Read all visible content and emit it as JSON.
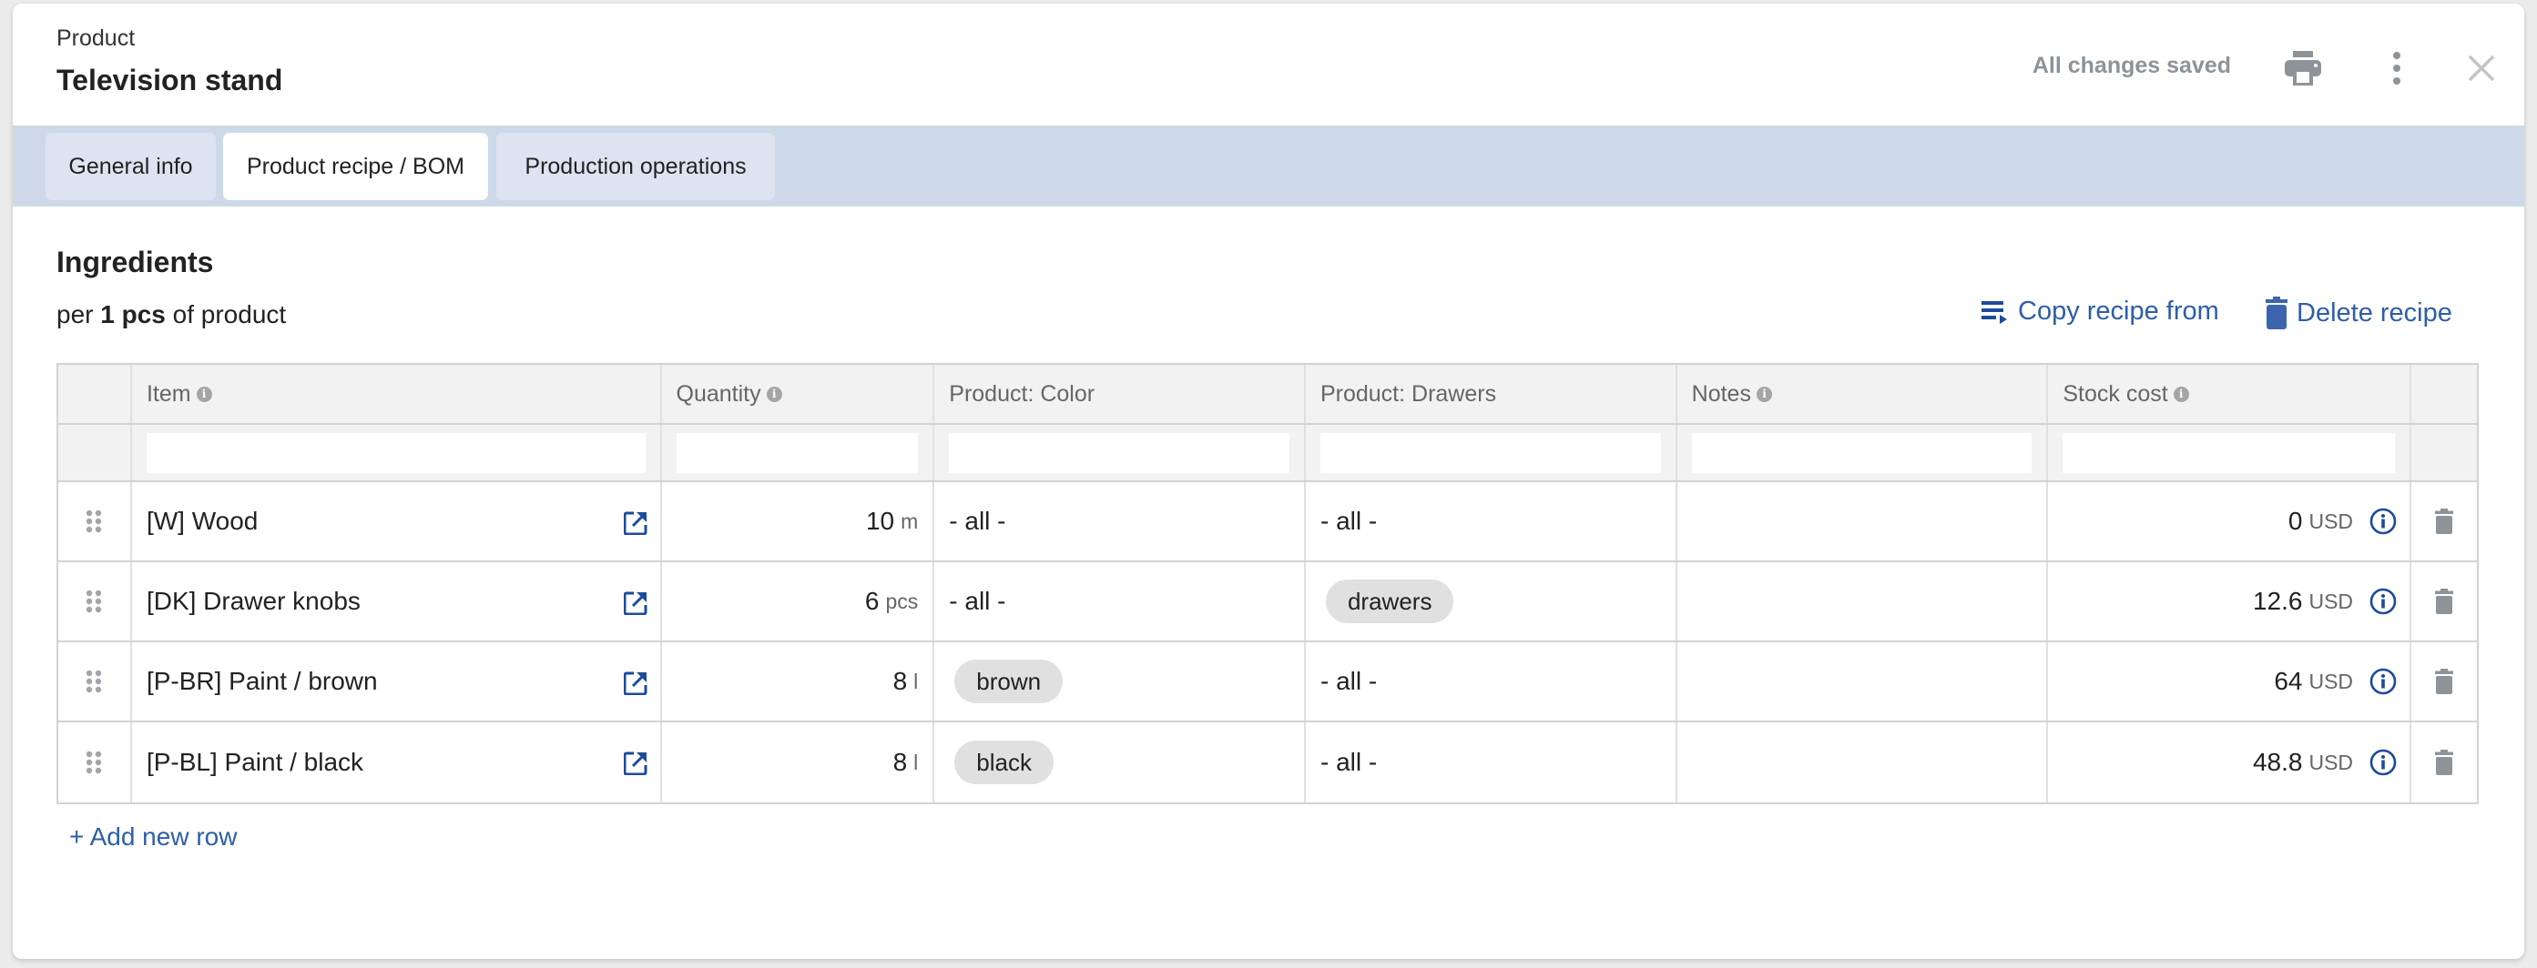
{
  "header": {
    "eyebrow": "Product",
    "title": "Television stand",
    "save_status": "All changes saved",
    "icons": [
      "print-icon",
      "more-vertical-icon",
      "close-icon"
    ]
  },
  "tabs": [
    {
      "label": "General info",
      "active": false
    },
    {
      "label": "Product recipe / BOM",
      "active": true
    },
    {
      "label": "Production operations",
      "active": false
    }
  ],
  "section": {
    "title": "Ingredients",
    "per_prefix": "per",
    "per_amount": "1 pcs",
    "per_suffix": "of product",
    "copy_label": "Copy recipe from",
    "delete_label": "Delete recipe"
  },
  "table": {
    "columns": [
      {
        "label": "Item",
        "info": true
      },
      {
        "label": "Quantity",
        "info": true
      },
      {
        "label": "Product: Color",
        "info": false
      },
      {
        "label": "Product: Drawers",
        "info": false
      },
      {
        "label": "Notes",
        "info": true
      },
      {
        "label": "Stock cost",
        "info": true
      }
    ],
    "filters": [
      "",
      "",
      "",
      "",
      "",
      ""
    ],
    "rows": [
      {
        "item": "[W] Wood",
        "qty": "10",
        "unit": "m",
        "color": "- all -",
        "color_chip": false,
        "drawers": "- all -",
        "drawers_chip": false,
        "notes": "",
        "cost": "0",
        "currency": "USD"
      },
      {
        "item": "[DK] Drawer knobs",
        "qty": "6",
        "unit": "pcs",
        "color": "- all -",
        "color_chip": false,
        "drawers": "drawers",
        "drawers_chip": true,
        "notes": "",
        "cost": "12.6",
        "currency": "USD"
      },
      {
        "item": "[P-BR] Paint / brown",
        "qty": "8",
        "unit": "l",
        "color": "brown",
        "color_chip": true,
        "drawers": "- all -",
        "drawers_chip": false,
        "notes": "",
        "cost": "64",
        "currency": "USD"
      },
      {
        "item": "[P-BL] Paint / black",
        "qty": "8",
        "unit": "l",
        "color": "black",
        "color_chip": true,
        "drawers": "- all -",
        "drawers_chip": false,
        "notes": "",
        "cost": "48.8",
        "currency": "USD"
      }
    ],
    "add_row_label": "+ Add new row"
  },
  "colors": {
    "accent": "#2d5ea8",
    "tab_bar": "#cdd9e8",
    "tab_inactive": "#dde3f0",
    "muted_text": "#8d9399",
    "chip": "#e0e0e0"
  }
}
